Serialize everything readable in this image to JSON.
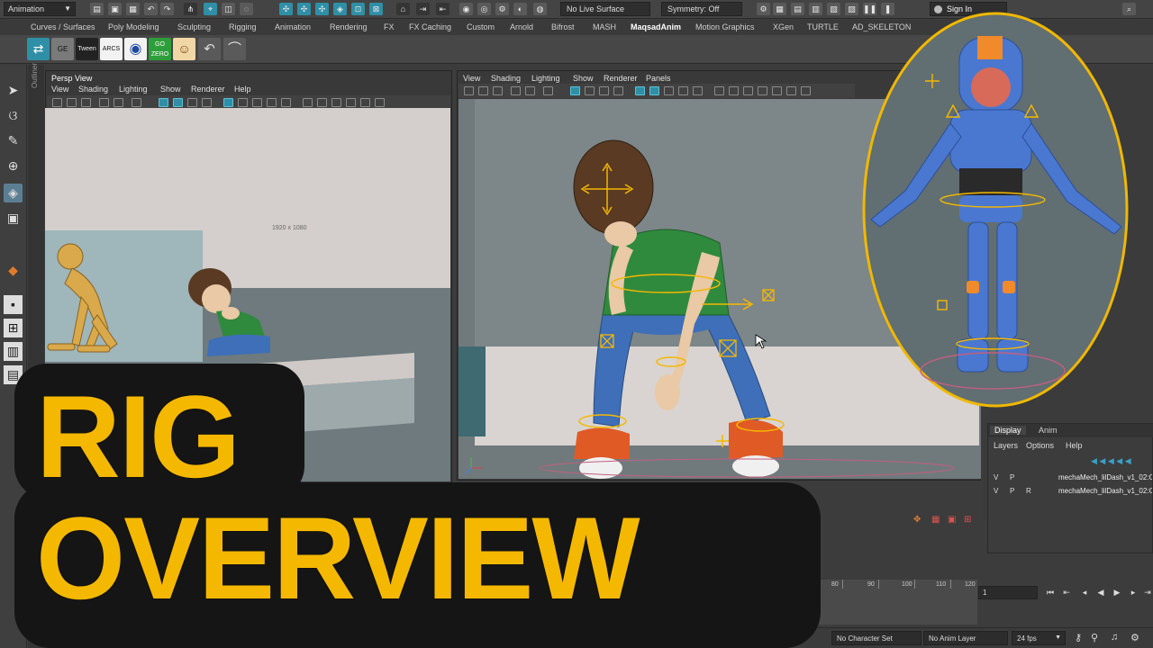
{
  "status_line": {
    "mode": "Animation",
    "live_surface": "No Live Surface",
    "symmetry": "Symmetry: Off",
    "sign_in": "Sign In"
  },
  "shelf_tabs": [
    "Curves / Surfaces",
    "Poly Modeling",
    "Sculpting",
    "Rigging",
    "Animation",
    "Rendering",
    "FX",
    "FX Caching",
    "Custom",
    "Arnold",
    "Bifrost",
    "MASH",
    "MaqsadAnim",
    "Motion Graphics",
    "XGen",
    "TURTLE",
    "AD_SKELETON"
  ],
  "active_shelf_tab": "MaqsadAnim",
  "shelf_buttons": [
    {
      "label": "",
      "icon": "swap-icon",
      "color": "#2f8fa6"
    },
    {
      "label": "GE",
      "icon": "graph-editor-icon",
      "color": "#7a7a7a"
    },
    {
      "label": "Tween",
      "icon": "tween-machine-icon",
      "color": "#222222"
    },
    {
      "label": "ARCS",
      "icon": "arcs-icon",
      "color": "#f2f2f2"
    },
    {
      "label": "",
      "icon": "eye-icon",
      "color": "#f2f2f2"
    },
    {
      "label": "GO ZERO",
      "icon": "go-zero-icon",
      "color": "#2e9e3a"
    },
    {
      "label": "",
      "icon": "character-face-icon",
      "color": "#f1d6a6"
    },
    {
      "label": "",
      "icon": "curve-tool-icon",
      "color": "#cfcfcf"
    }
  ],
  "outliner_label": "Outliner",
  "left_panel": {
    "title": "Persp View",
    "menus": [
      "View",
      "Shading",
      "Lighting",
      "Show",
      "Renderer",
      "Help"
    ],
    "resolution": "1920 x 1080"
  },
  "right_panel": {
    "menus": [
      "View",
      "Shading",
      "Lighting",
      "Show",
      "Renderer",
      "Panels"
    ]
  },
  "layer_editor": {
    "tabs": [
      "Display",
      "Anim"
    ],
    "active_tab": "Display",
    "menus": [
      "Layers",
      "Options",
      "Help"
    ],
    "layers": [
      {
        "v": "V",
        "p": "P",
        "r": "",
        "name": "mechaMech_lilDash_v1_02:C"
      },
      {
        "v": "V",
        "p": "P",
        "r": "R",
        "name": "mechaMech_lilDash_v1_02:G"
      }
    ]
  },
  "time_slider": {
    "ticks": [
      "80",
      "90",
      "100",
      "110",
      "120"
    ],
    "current_frame": "1"
  },
  "range_bar": {
    "character_set": "No Character Set",
    "anim_layer": "No Anim Layer",
    "fps": "24 fps"
  },
  "title": {
    "line1": "RIG",
    "line2": "OVERVIEW"
  },
  "colors": {
    "title_yellow": "#f5b800",
    "maya_teal": "#2f8fa6",
    "inset_border": "#f0b800",
    "character_shirt": "#2f8a3e",
    "character_pants": "#3e6fb8",
    "robot_blue": "#4a78d0"
  }
}
